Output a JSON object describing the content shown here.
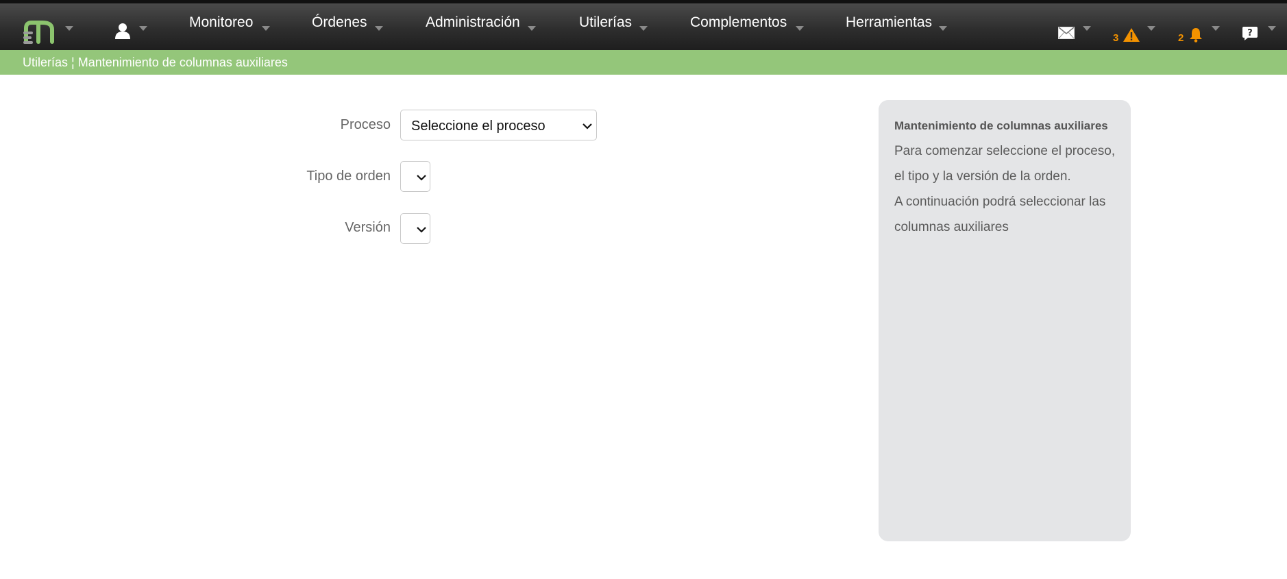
{
  "navbar": {
    "menu": [
      {
        "key": "monitoreo",
        "label": "Monitoreo"
      },
      {
        "key": "ordenes",
        "label": "Órdenes"
      },
      {
        "key": "administracion",
        "label": "Administración"
      },
      {
        "key": "utilerias",
        "label": "Utilerías"
      },
      {
        "key": "complementos",
        "label": "Complementos"
      },
      {
        "key": "herramientas",
        "label": "Herramientas"
      }
    ],
    "alerts_count": "3",
    "notifications_count": "2",
    "icons": [
      "app-logo",
      "user-icon",
      "mail-icon",
      "warning-icon",
      "bell-icon",
      "help-icon"
    ],
    "accent_color": "#f39200"
  },
  "breadcrumb": {
    "section": "Utilerías",
    "separator": "¦",
    "page": "Mantenimiento de columnas auxiliares",
    "bg_color": "#94c67a"
  },
  "form": {
    "proceso_label": "Proceso",
    "proceso_value": "Seleccione el proceso",
    "tipo_label": "Tipo de orden",
    "tipo_value": "",
    "version_label": "Versión",
    "version_value": ""
  },
  "help": {
    "title": "Mantenimiento de columnas auxiliares",
    "paragraph1": "Para comenzar seleccione el proceso, el tipo y la versión de la orden.",
    "paragraph2": "A continuación podrá seleccionar las columnas auxiliares"
  }
}
